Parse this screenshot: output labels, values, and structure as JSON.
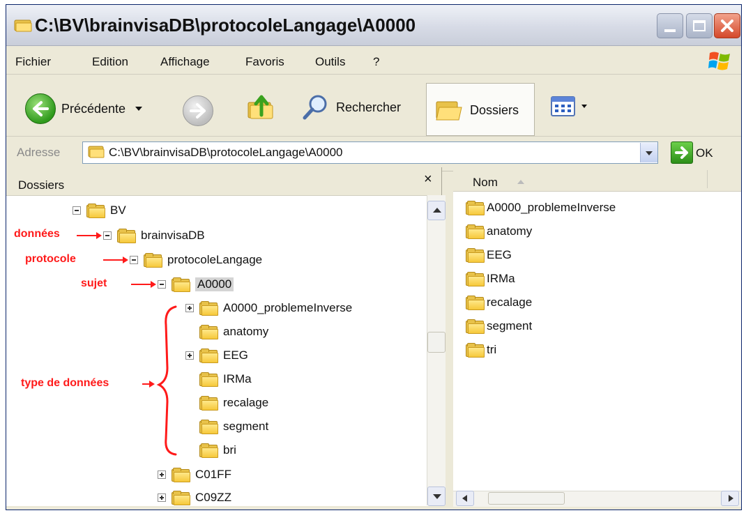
{
  "window": {
    "title": "C:\\BV\\brainvisaDB\\protocoleLangage\\A0000"
  },
  "menu": [
    "Fichier",
    "Edition",
    "Affichage",
    "Favoris",
    "Outils",
    "?"
  ],
  "toolbar": {
    "back_label": "Précédente",
    "search_label": "Rechercher",
    "folders_label": "Dossiers"
  },
  "address": {
    "label": "Adresse",
    "value": "C:\\BV\\brainvisaDB\\protocoleLangage\\A0000",
    "go_label": "OK"
  },
  "folders_pane": {
    "title": "Dossiers",
    "close": "×",
    "tree": [
      {
        "label": "BV",
        "expander": "minus"
      },
      {
        "label": "brainvisaDB",
        "expander": "minus"
      },
      {
        "label": "protocoleLangage",
        "expander": "minus"
      },
      {
        "label": "A0000",
        "expander": "minus",
        "selected": true
      },
      {
        "label": "A0000_problemeInverse",
        "expander": "plus"
      },
      {
        "label": "anatomy",
        "expander": "none"
      },
      {
        "label": "EEG",
        "expander": "plus"
      },
      {
        "label": "IRMa",
        "expander": "none"
      },
      {
        "label": "recalage",
        "expander": "none"
      },
      {
        "label": "segment",
        "expander": "none"
      },
      {
        "label": "bri",
        "expander": "none"
      },
      {
        "label": "C01FF",
        "expander": "plus"
      },
      {
        "label": "C09ZZ",
        "expander": "plus"
      }
    ]
  },
  "annotations": {
    "donnees": "données",
    "protocole": "protocole",
    "sujet": "sujet",
    "type": "type de données"
  },
  "files_pane": {
    "column_name": "Nom",
    "items": [
      "A0000_problemeInverse",
      "anatomy",
      "EEG",
      "IRMa",
      "recalage",
      "segment",
      "tri"
    ]
  },
  "colors": {
    "annotation": "#ff1a1a",
    "folder": "#f6c83a",
    "selection": "#d4d4d4"
  }
}
